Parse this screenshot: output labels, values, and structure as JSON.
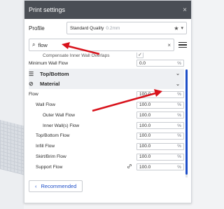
{
  "panel": {
    "title": "Print settings",
    "close_icon": "×"
  },
  "profile": {
    "label": "Profile",
    "value": "Standard Quality",
    "subvalue": "0.2mm",
    "star": "★",
    "chevron": "▾"
  },
  "search": {
    "value": "flow",
    "icon": "⌕",
    "clear": "×"
  },
  "settings": {
    "partial_label": "Compensate Inner Wall Overlaps",
    "checkmark": "✓",
    "min_wall_flow": {
      "label": "Minimum Wall Flow",
      "value": "0.0",
      "unit": "%"
    },
    "top_bottom": {
      "label": "Top/Bottom",
      "icon": "☰",
      "chevron": "⌄"
    },
    "material": {
      "label": "Material",
      "icon": "⊘",
      "chevron": "⌄"
    },
    "rows": [
      {
        "label": "Flow",
        "value": "100.0",
        "unit": "%"
      },
      {
        "label": "Wall Flow",
        "value": "100.0",
        "unit": "%"
      },
      {
        "label": "Outer Wall Flow",
        "value": "100.0",
        "unit": "%"
      },
      {
        "label": "Inner Wall(s) Flow",
        "value": "100.0",
        "unit": "%"
      },
      {
        "label": "Top/Bottom Flow",
        "value": "100.0",
        "unit": "%"
      },
      {
        "label": "Infill Flow",
        "value": "100.0",
        "unit": "%"
      },
      {
        "label": "Skirt/Brim Flow",
        "value": "100.0",
        "unit": "%"
      },
      {
        "label": "Support Flow",
        "value": "100.0",
        "unit": "%"
      }
    ]
  },
  "footer": {
    "recommended_label": "Recommended",
    "back_icon": "‹"
  },
  "colors": {
    "accent": "#1e4fc8",
    "header": "#4a4e55",
    "arrow": "#d8121b"
  }
}
